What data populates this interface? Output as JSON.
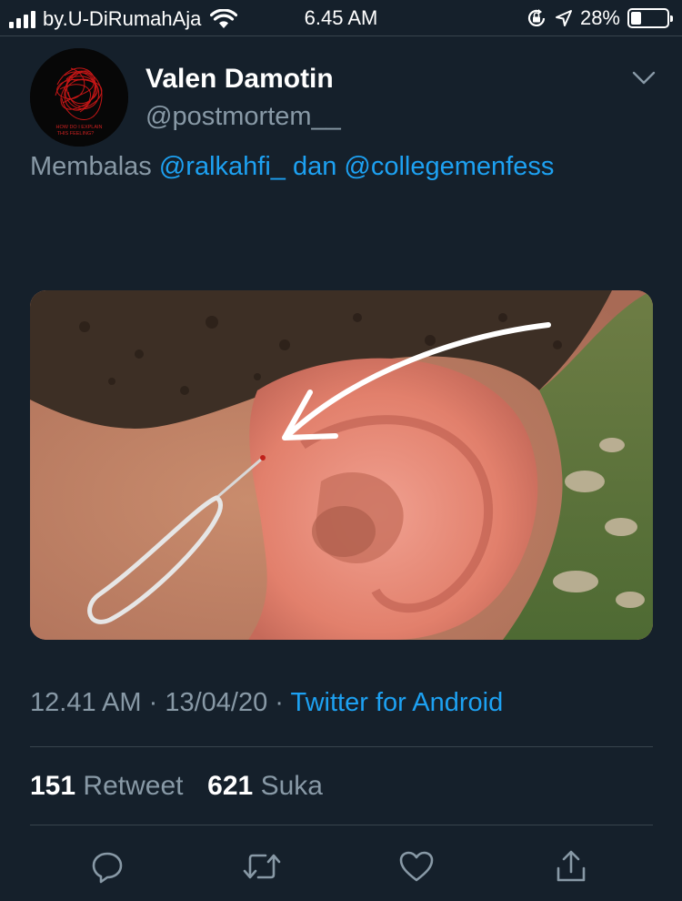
{
  "status_bar": {
    "carrier": "by.U-DiRumahAja",
    "time": "6.45 AM",
    "battery_percent": "28%",
    "battery_level": 0.28,
    "icons": [
      "signal-icon",
      "wifi-icon",
      "orientation-lock-icon",
      "location-icon",
      "battery-icon"
    ]
  },
  "tweet": {
    "author": {
      "display_name": "Valen Damotin",
      "handle": "@postmortem__",
      "avatar_caption_line1": "HOW DO I EXPLAIN",
      "avatar_caption_line2": "THIS FEELING?"
    },
    "reply_prefix": "Membalas",
    "reply_mention_1": "@ralkahfi_",
    "reply_joiner": "dan",
    "reply_mention_2": "@collegemenfess",
    "time": "12.41 AM",
    "separator": "·",
    "date": "13/04/20",
    "source": "Twitter for Android",
    "retweet_count": "151",
    "retweet_label": "Retweet",
    "like_count": "621",
    "like_label": "Suka"
  },
  "colors": {
    "background": "#15202b",
    "link": "#1da1f2",
    "secondary_text": "#8899a6",
    "divider": "#38444d"
  },
  "actions": [
    "reply-icon",
    "retweet-icon",
    "like-icon",
    "share-icon"
  ]
}
